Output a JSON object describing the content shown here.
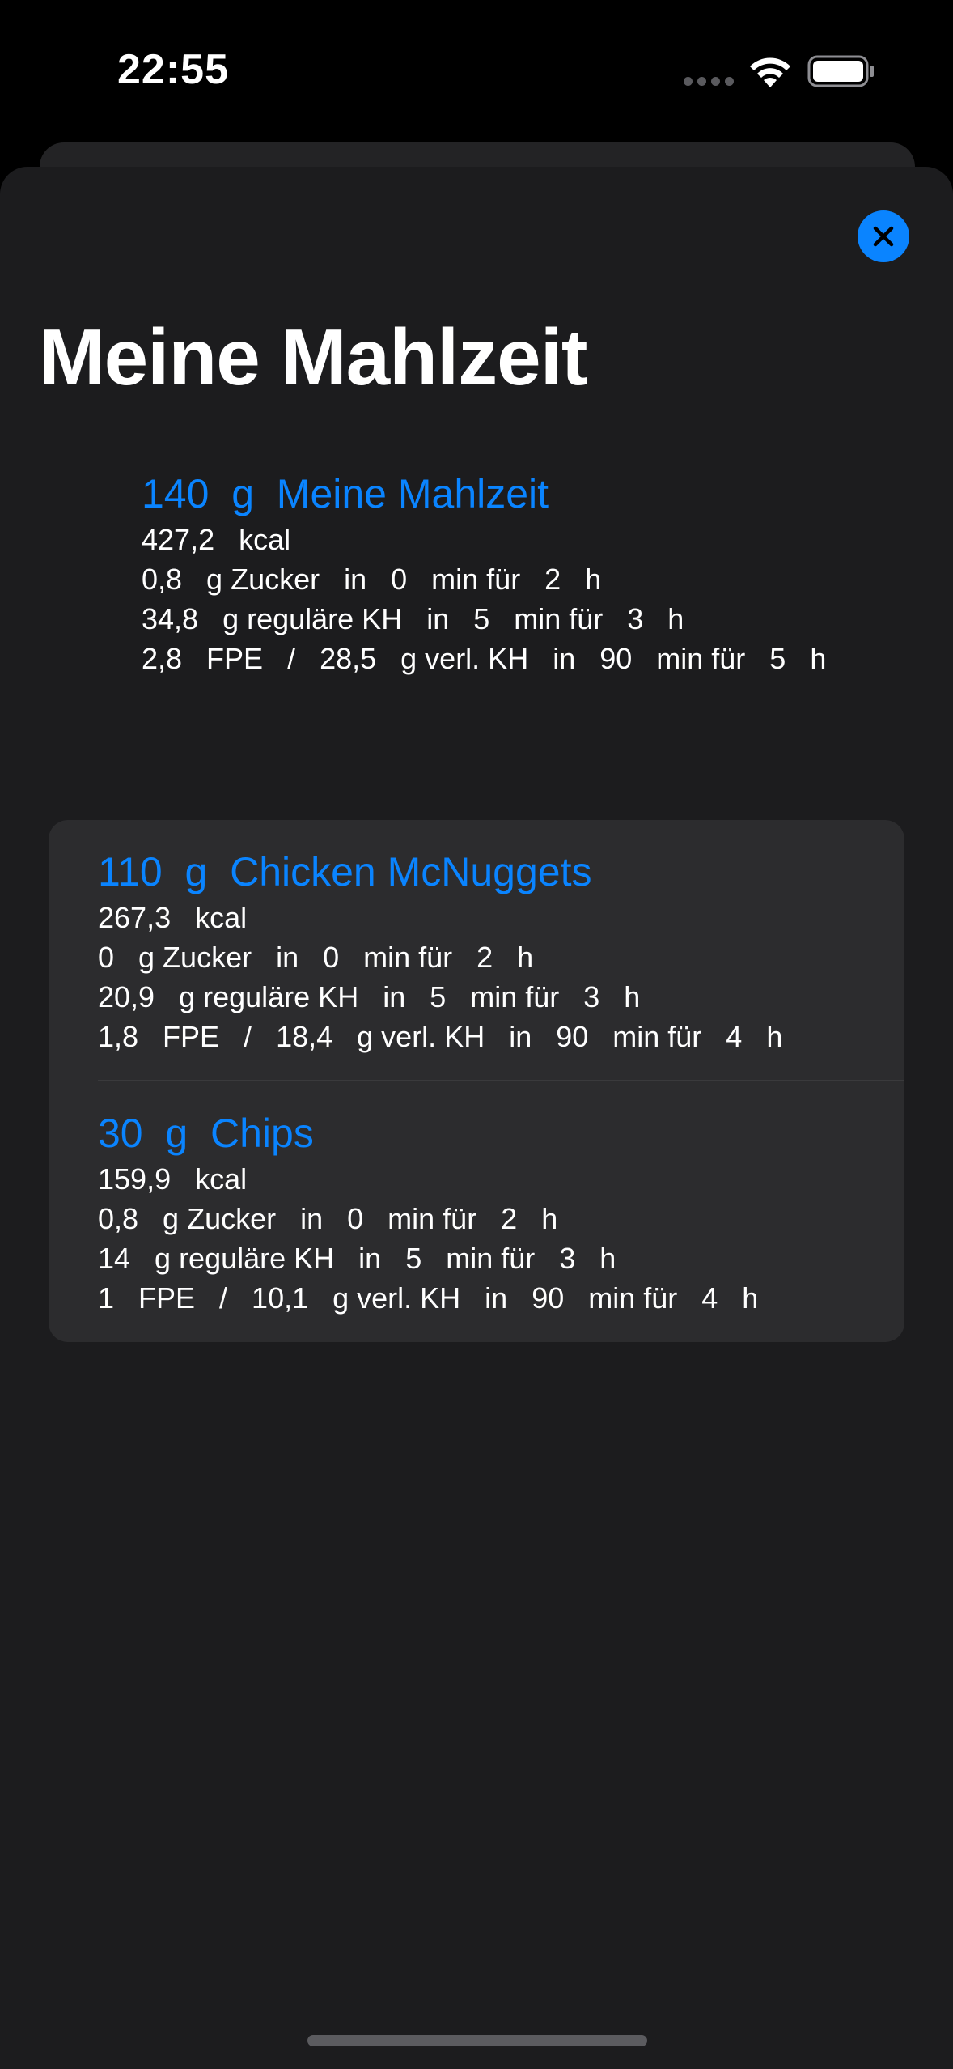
{
  "status_bar": {
    "time": "22:55",
    "signal_icon": "cellular-signal-dots-icon",
    "wifi_icon": "wifi-icon",
    "battery_icon": "battery-icon"
  },
  "sheet": {
    "title": "Meine Mahlzeit",
    "close_icon": "close-x-icon",
    "accent_color": "#0a84ff"
  },
  "summary": {
    "title": "140  g  Meine Mahlzeit",
    "lines": [
      "427,2   kcal",
      "0,8   g Zucker   in   0   min für   2   h",
      "34,8   g reguläre KH   in   5   min für   3   h",
      "2,8   FPE   /   28,5   g verl. KH   in   90   min für   5   h"
    ]
  },
  "items": [
    {
      "title": "110  g  Chicken McNuggets",
      "lines": [
        "267,3   kcal",
        "0   g Zucker   in   0   min für   2   h",
        "20,9   g reguläre KH   in   5   min für   3   h",
        "1,8   FPE   /   18,4   g verl. KH   in   90   min für   4   h"
      ]
    },
    {
      "title": "30  g  Chips",
      "lines": [
        "159,9   kcal",
        "0,8   g Zucker   in   0   min für   2   h",
        "14   g reguläre KH   in   5   min für   3   h",
        "1   FPE   /   10,1   g verl. KH   in   90   min für   4   h"
      ]
    }
  ]
}
